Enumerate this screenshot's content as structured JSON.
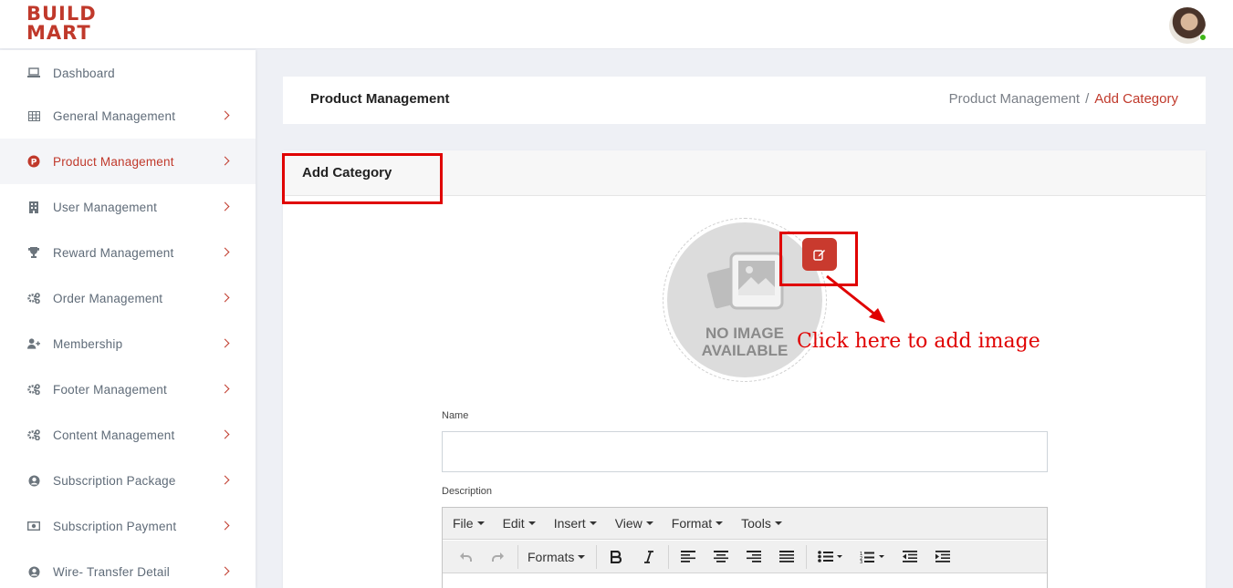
{
  "app": {
    "logo_line1": "BUILD",
    "logo_line2": "MART"
  },
  "sidebar": {
    "items": [
      {
        "label": "Dashboard",
        "icon": "laptop-icon"
      },
      {
        "label": "General Management",
        "icon": "table-icon"
      },
      {
        "label": "Product Management",
        "icon": "product-p-icon",
        "active": true
      },
      {
        "label": "User Management",
        "icon": "building-icon"
      },
      {
        "label": "Reward Management",
        "icon": "trophy-icon"
      },
      {
        "label": "Order Management",
        "icon": "cogs-icon"
      },
      {
        "label": "Membership",
        "icon": "user-plus-icon"
      },
      {
        "label": "Footer Management",
        "icon": "cogs-icon"
      },
      {
        "label": "Content Management",
        "icon": "cogs-icon"
      },
      {
        "label": "Subscription Package",
        "icon": "user-circle-icon"
      },
      {
        "label": "Subscription Payment",
        "icon": "money-icon"
      },
      {
        "label": "Wire- Transfer Detail",
        "icon": "user-circle-icon"
      }
    ]
  },
  "header": {
    "title": "Product Management",
    "breadcrumb": [
      "Product Management",
      "/",
      "Add Category"
    ]
  },
  "card": {
    "title": "Add Category",
    "noimage_line1": "NO IMAGE",
    "noimage_line2": "AVAILABLE",
    "callout": "Click here to add image"
  },
  "form": {
    "name_label": "Name",
    "name_value": "",
    "description_label": "Description"
  },
  "editor": {
    "menus": [
      "File",
      "Edit",
      "Insert",
      "View",
      "Format",
      "Tools"
    ],
    "formats_label": "Formats"
  },
  "colors": {
    "brand": "#c0392b",
    "annotation": "#e00000"
  }
}
